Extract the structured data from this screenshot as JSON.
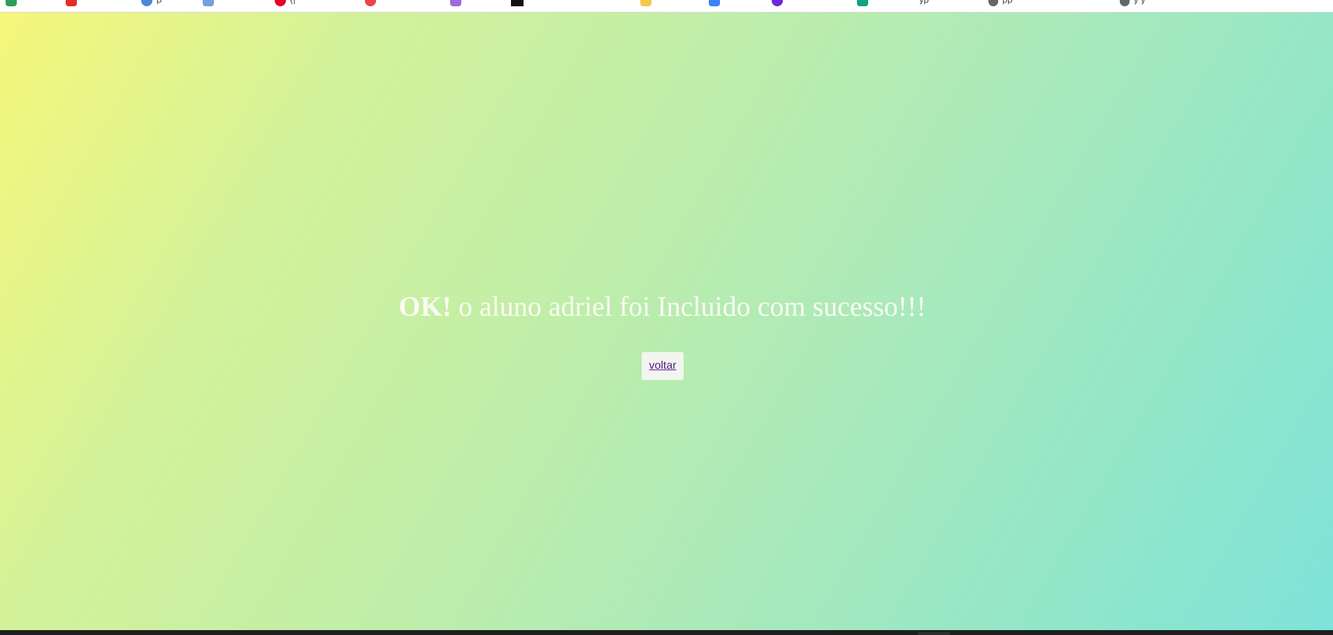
{
  "bookmarks": [
    {
      "name": "bookmark-1",
      "icon_color": "#2e9e5b",
      "text": ""
    },
    {
      "name": "bookmark-youtube",
      "icon_color": "#e52d27",
      "text": ""
    },
    {
      "name": "bookmark-3",
      "icon_color": "#4a89dc",
      "text": "p"
    },
    {
      "name": "bookmark-4",
      "icon_color": "#7a9ce0",
      "text": ""
    },
    {
      "name": "bookmark-pinterest",
      "icon_color": "#e60023",
      "text": "(|"
    },
    {
      "name": "bookmark-6",
      "icon_color": "#e8454b",
      "text": ""
    },
    {
      "name": "bookmark-7",
      "icon_color": "#9c6ade",
      "text": ""
    },
    {
      "name": "bookmark-8",
      "icon_color": "#111111",
      "text": ""
    },
    {
      "name": "bookmark-9",
      "icon_color": "#f2c94c",
      "text": ""
    },
    {
      "name": "bookmark-10",
      "icon_color": "#3b82f6",
      "text": ""
    },
    {
      "name": "bookmark-11",
      "icon_color": "#6d28d9",
      "text": ""
    },
    {
      "name": "bookmark-12",
      "icon_color": "#10a37f",
      "text": "yp"
    },
    {
      "name": "bookmark-13",
      "icon_color": "#666666",
      "text": "pp"
    },
    {
      "name": "bookmark-14",
      "icon_color": "#666666",
      "text": "y y"
    }
  ],
  "message": {
    "ok": "OK!",
    "text": " o aluno adriel foi Incluido com sucesso!!!"
  },
  "back_link": {
    "label": "voltar"
  },
  "colors": {
    "gradient_start": "#f5f77a",
    "gradient_end": "#7fe3da",
    "message_text": "#fbfbf2",
    "link": "#551a8b"
  }
}
